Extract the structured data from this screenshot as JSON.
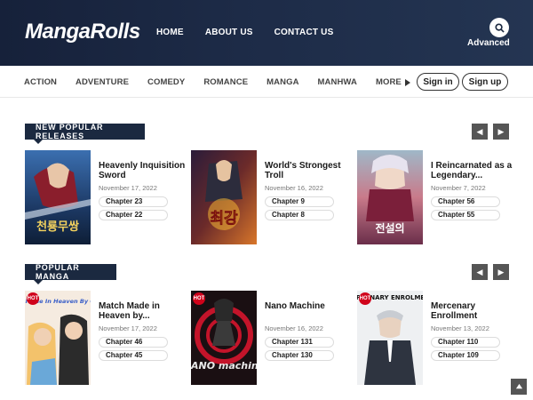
{
  "header": {
    "logo": "MangaRolls",
    "nav": [
      "HOME",
      "ABOUT US",
      "CONTACT US"
    ],
    "advanced_label": "Advanced"
  },
  "genres": {
    "items": [
      "ACTION",
      "ADVENTURE",
      "COMEDY",
      "ROMANCE",
      "MANGA",
      "MANHWA"
    ],
    "more_label": "MORE"
  },
  "auth": {
    "signin": "Sign in",
    "signup": "Sign up"
  },
  "sections": [
    {
      "title": "NEW POPULAR RELEASES",
      "cards": [
        {
          "title": "Heavenly Inquisition Sword",
          "date": "November 17, 2022",
          "chapters": [
            "Chapter 23",
            "Chapter 22"
          ],
          "cover_text": "천룡무쌍"
        },
        {
          "title": "World's Strongest Troll",
          "date": "November 16, 2022",
          "chapters": [
            "Chapter 9",
            "Chapter 8"
          ],
          "cover_text": "최강"
        },
        {
          "title": "I Reincarnated as a Legendary...",
          "date": "November 7, 2022",
          "chapters": [
            "Chapter 56",
            "Chapter 55"
          ],
          "cover_text": "전설의"
        }
      ]
    },
    {
      "title": "POPULAR MANGA",
      "cards": [
        {
          "title": "Match Made in Heaven by...",
          "date": "November 17, 2022",
          "chapters": [
            "Chapter 46",
            "Chapter 45"
          ],
          "cover_text": "Match Made In Heaven By Chance",
          "hot": "HOT"
        },
        {
          "title": "Nano Machine",
          "date": "November 16, 2022",
          "chapters": [
            "Chapter 131",
            "Chapter 130"
          ],
          "cover_text": "NANO machine",
          "hot": "HOT"
        },
        {
          "title": "Mercenary Enrollment",
          "date": "November 13, 2022",
          "chapters": [
            "Chapter 110",
            "Chapter 109"
          ],
          "cover_text": "MERCENARY ENROLMENT",
          "hot": "HOT"
        }
      ]
    }
  ],
  "icons": {
    "search": "search-icon",
    "more": "triangle-right-icon",
    "prev": "chevron-left-icon",
    "next": "chevron-right-icon",
    "top": "arrow-up-icon"
  }
}
